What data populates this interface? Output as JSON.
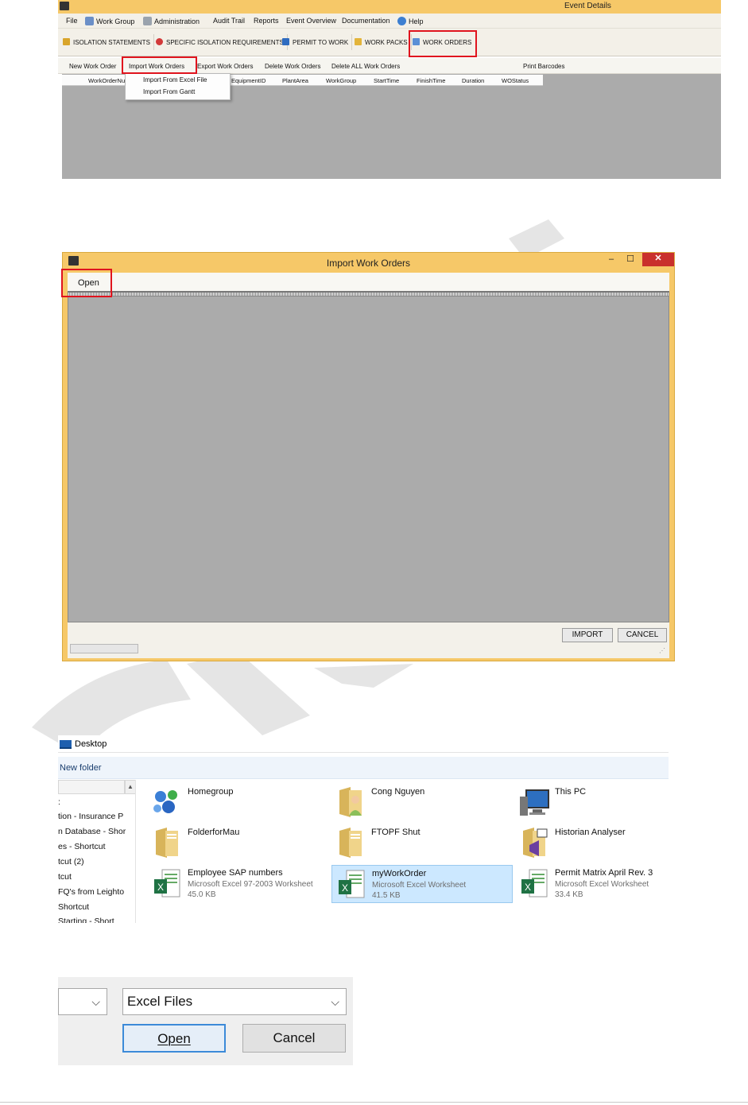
{
  "shot1": {
    "window_title": "Event Details",
    "menu": [
      "File",
      "Work Group",
      "Administration",
      "Audit Trail",
      "Reports",
      "Event Overview",
      "Documentation",
      "Help"
    ],
    "tabs": [
      "ISOLATION STATEMENTS",
      "SPECIFIC ISOLATION REQUIREMENTS",
      "PERMIT TO WORK",
      "WORK PACKS",
      "WORK ORDERS"
    ],
    "actions": [
      "New Work Order",
      "Import Work Orders",
      "Export Work Orders",
      "Delete Work Orders",
      "Delete ALL Work Orders",
      "Print Barcodes"
    ],
    "columns": [
      "WorkOrderNu",
      "EquipmentID",
      "PlantArea",
      "WorkGroup",
      "StartTime",
      "FinishTime",
      "Duration",
      "WOStatus"
    ],
    "dropdown": [
      "Import From Excel File",
      "Import From Gantt"
    ]
  },
  "shot2": {
    "window_title": "Import Work Orders",
    "menu_open": "Open",
    "import_button": "IMPORT",
    "cancel_button": "CANCEL",
    "minimize_glyph": "–",
    "maximize_glyph": "☐",
    "close_glyph": "✕"
  },
  "shot3": {
    "location": "Desktop",
    "new_folder": "New folder",
    "nav_items": [
      ": ",
      "tion - Insurance P",
      "n Database - Shor",
      "es - Shortcut",
      "tcut (2)",
      "tcut",
      "FQ's from Leighto",
      "Shortcut",
      "Starting - Short"
    ],
    "files": [
      {
        "name": "Homegroup",
        "type": "",
        "size": "",
        "icon": "homegroup-icon"
      },
      {
        "name": "Cong Nguyen",
        "type": "",
        "size": "",
        "icon": "user-folder-icon"
      },
      {
        "name": "This PC",
        "type": "",
        "size": "",
        "icon": "computer-icon"
      },
      {
        "name": "FolderforMau",
        "type": "",
        "size": "",
        "icon": "folder-icon"
      },
      {
        "name": "FTOPF Shut",
        "type": "",
        "size": "",
        "icon": "folder-icon"
      },
      {
        "name": "Historian Analyser",
        "type": "",
        "size": "",
        "icon": "vs-folder-icon"
      },
      {
        "name": "Employee SAP numbers",
        "type": "Microsoft Excel 97-2003 Worksheet",
        "size": "45.0 KB",
        "icon": "excel-icon"
      },
      {
        "name": "myWorkOrder",
        "type": "Microsoft Excel Worksheet",
        "size": "41.5 KB",
        "icon": "excel-icon"
      },
      {
        "name": "Permit Matrix April Rev. 3",
        "type": "Microsoft Excel Worksheet",
        "size": "33.4 KB",
        "icon": "excel-icon"
      }
    ],
    "colors": {
      "selected_bg": "#cce8ff",
      "excel_green": "#1f7244"
    }
  },
  "shot4": {
    "filter": "Excel Files",
    "open_button": "Open",
    "cancel_button": "Cancel"
  }
}
